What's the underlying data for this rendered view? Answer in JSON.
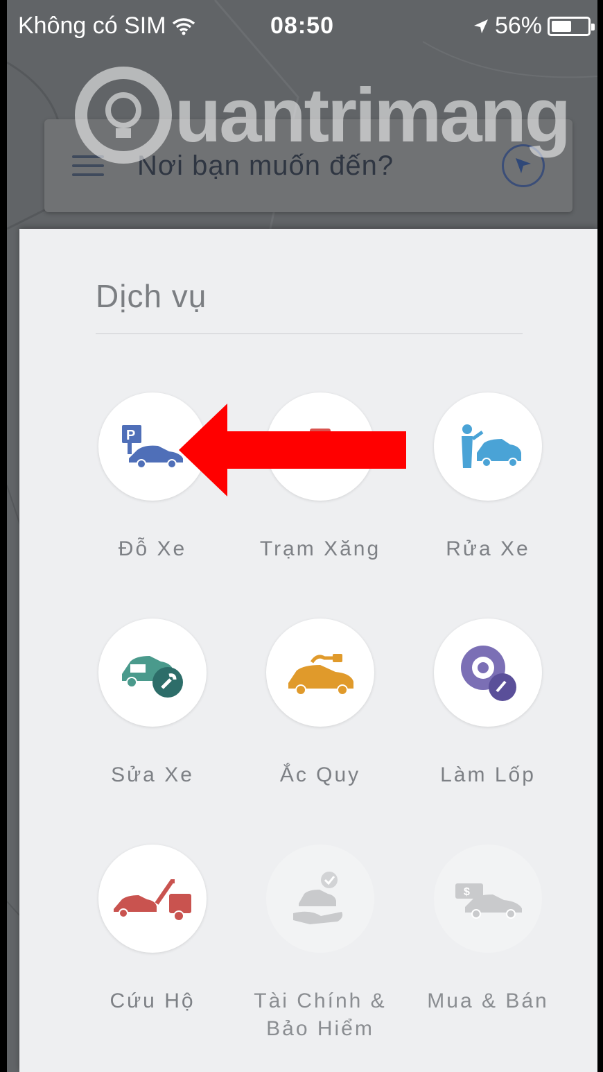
{
  "status_bar": {
    "carrier": "Không có SIM",
    "time": "08:50",
    "battery": "56%",
    "battery_level": 0.56
  },
  "watermark": {
    "brand": "uantrimang"
  },
  "search": {
    "placeholder": "Nơi bạn muốn đến?"
  },
  "services": {
    "title": "Dịch vụ",
    "items": [
      {
        "label": "Đỗ Xe",
        "icon": "parking-car-icon",
        "color": "#4f6fb8",
        "enabled": true
      },
      {
        "label": "Trạm Xăng",
        "icon": "gas-station-icon",
        "color": "#d9534f",
        "enabled": true
      },
      {
        "label": "Rửa Xe",
        "icon": "car-wash-icon",
        "color": "#4aa3d6",
        "enabled": true
      },
      {
        "label": "Sửa Xe",
        "icon": "car-repair-icon",
        "color": "#4a9a8c",
        "enabled": true
      },
      {
        "label": "Ắc Quy",
        "icon": "battery-car-icon",
        "color": "#e09a2b",
        "enabled": true
      },
      {
        "label": "Làm Lốp",
        "icon": "tire-icon",
        "color": "#7b6fb5",
        "enabled": true
      },
      {
        "label": "Cứu Hộ",
        "icon": "tow-truck-icon",
        "color": "#c9534f",
        "enabled": true
      },
      {
        "label": "Tài Chính & Bảo Hiểm",
        "icon": "finance-insurance-icon",
        "color": "#c9cacc",
        "enabled": false
      },
      {
        "label": "Mua & Bán",
        "icon": "buy-sell-icon",
        "color": "#c9cacc",
        "enabled": false
      }
    ]
  },
  "annotation": {
    "arrow_color": "#ff0000"
  }
}
